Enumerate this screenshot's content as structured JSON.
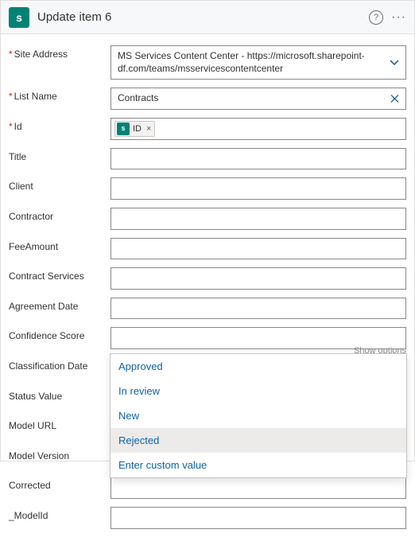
{
  "header": {
    "app_initial": "s",
    "title": "Update item 6",
    "help_glyph": "?",
    "ellipsis": "···"
  },
  "fields": {
    "site_address": {
      "label": "Site Address",
      "value": "MS Services Content Center - https://microsoft.sharepoint-df.com/teams/msservicescontentcenter"
    },
    "list_name": {
      "label": "List Name",
      "value": "Contracts"
    },
    "id": {
      "label": "Id",
      "token_icon": "s",
      "token_text": "ID",
      "token_remove": "×"
    },
    "title": {
      "label": "Title",
      "value": ""
    },
    "client": {
      "label": "Client",
      "value": ""
    },
    "contractor": {
      "label": "Contractor",
      "value": ""
    },
    "fee_amount": {
      "label": "FeeAmount",
      "value": ""
    },
    "contract_services": {
      "label": "Contract Services",
      "value": ""
    },
    "agreement_date": {
      "label": "Agreement Date",
      "value": ""
    },
    "confidence_score": {
      "label": "Confidence Score",
      "value": ""
    },
    "classification_date": {
      "label": "Classification Date",
      "value": "",
      "show_options": "Show options"
    },
    "status_value": {
      "label": "Status Value",
      "value": "Rejected"
    },
    "model_url": {
      "label": "Model URL",
      "value": ""
    },
    "model_version": {
      "label": "Model Version",
      "value": ""
    },
    "corrected": {
      "label": "Corrected",
      "value": ""
    },
    "model_id": {
      "label": "_ModelId",
      "value": ""
    }
  },
  "dropdown": {
    "options": [
      "Approved",
      "In review",
      "New",
      "Rejected",
      "Enter custom value"
    ],
    "selected": "Rejected"
  }
}
